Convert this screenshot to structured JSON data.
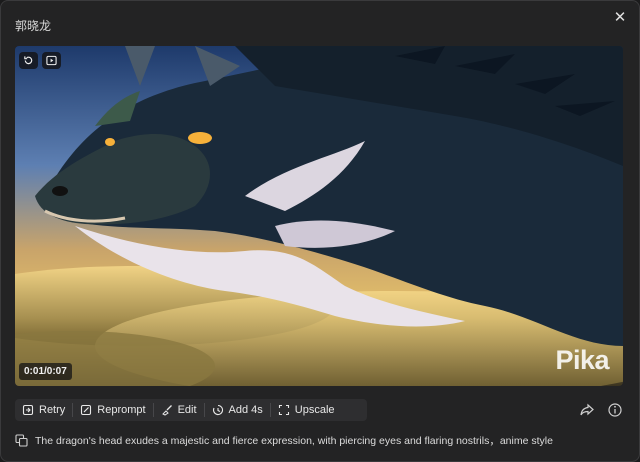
{
  "window": {
    "title": "郭晓龙"
  },
  "icons": {
    "close": "close-icon",
    "replay": "replay-icon",
    "play": "play-icon",
    "retry": "retry-icon",
    "reprompt": "edit-pen-icon",
    "edit": "brush-icon",
    "add4s": "add-time-icon",
    "upscale": "expand-icon",
    "share": "share-icon",
    "info": "info-icon",
    "copy": "copy-icon"
  },
  "video": {
    "time": "0:01/0:07",
    "watermark": "Pika"
  },
  "toolbar": {
    "retry": "Retry",
    "reprompt": "Reprompt",
    "edit": "Edit",
    "add4s": "Add 4s",
    "upscale": "Upscale"
  },
  "prompt": {
    "text": "The dragon's head exudes a majestic and fierce expression, with piercing eyes and flaring nostrils，anime style"
  }
}
